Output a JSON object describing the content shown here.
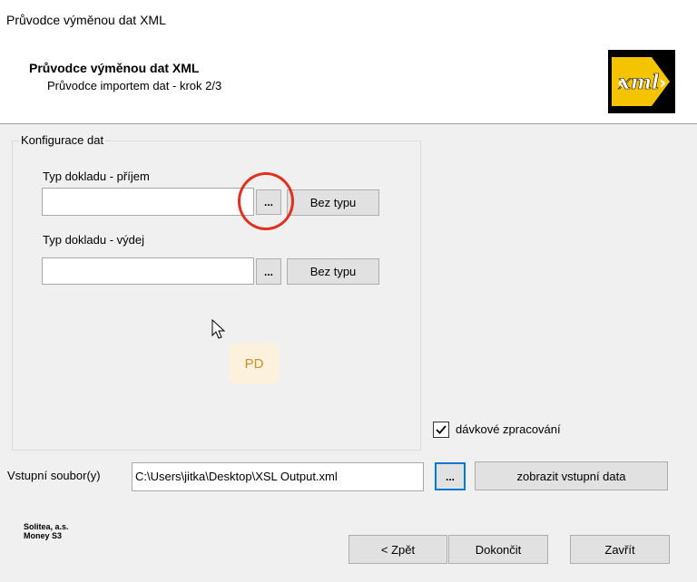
{
  "window": {
    "title": "Průvodce výměnou dat XML"
  },
  "header": {
    "title": "Průvodce výměnou dat XML",
    "subtitle": "Průvodce importem dat - krok 2/3",
    "logo_text": "xml"
  },
  "config": {
    "group_label": "Konfigurace dat",
    "receipt": {
      "label": "Typ dokladu - příjem",
      "value": "",
      "browse_label": "...",
      "none_label": "Bez typu"
    },
    "issue": {
      "label": "Typ dokladu - výdej",
      "value": "",
      "browse_label": "...",
      "none_label": "Bez typu"
    }
  },
  "overlay": {
    "badge": "PD"
  },
  "batch": {
    "label": "dávkové zpracování",
    "checked": true
  },
  "input_file": {
    "label": "Vstupní soubor(y)",
    "value": "C:\\Users\\jitka\\Desktop\\XSL Output.xml",
    "browse_label": "...",
    "show_data_label": "zobrazit vstupní data"
  },
  "company": {
    "line1": "Solitea, a.s.",
    "line2": "Money S3"
  },
  "buttons": {
    "back": "< Zpět",
    "finish": "Dokončit",
    "close": "Zavřít"
  },
  "colors": {
    "highlight_circle": "#e0301e",
    "focus_blue": "#0078d7",
    "logo_yellow": "#f5c400"
  }
}
